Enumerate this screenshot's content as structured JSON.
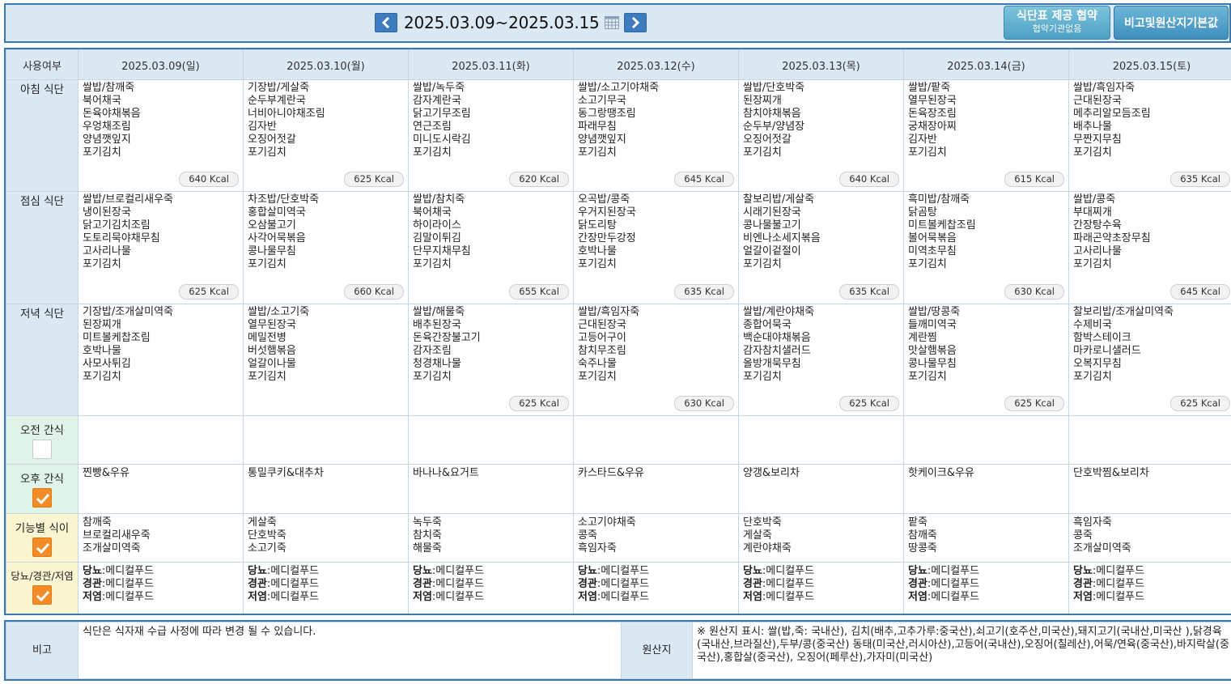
{
  "header": {
    "date_range": "2025.03.09~2025.03.15",
    "agree_button_line1": "식단표 제공 협약",
    "agree_button_line2": "협약기관없음",
    "note_button": "비고및원산지기본값"
  },
  "table": {
    "usage_header": "사용여부",
    "days": [
      "2025.03.09(일)",
      "2025.03.10(월)",
      "2025.03.11(화)",
      "2025.03.12(수)",
      "2025.03.13(목)",
      "2025.03.14(금)",
      "2025.03.15(토)"
    ],
    "meals": [
      {
        "label": "아침 식단",
        "cells": [
          {
            "text": "쌀밥/참깨죽\n북어채국\n돈육야채볶음\n우엉채조림\n양념깻잎지\n포기김치",
            "kcal": "640 Kcal"
          },
          {
            "text": "기장밥/게살죽\n순두부계란국\n너비아니야채조림\n김자반\n오징어젓갈\n포기김치",
            "kcal": "625 Kcal"
          },
          {
            "text": "쌀밥/녹두죽\n감자계란국\n닭고기무조림\n연근조림\n미니도시락김\n포기김치",
            "kcal": "620 Kcal"
          },
          {
            "text": "쌀밥/소고기야채죽\n소고기무국\n동그랑땡조림\n파래무침\n양념깻잎지\n포기김치",
            "kcal": "645 Kcal"
          },
          {
            "text": "쌀밥/단호박죽\n된장찌개\n참치야채볶음\n순두부/양념장\n오징어젓갈\n포기김치",
            "kcal": "640 Kcal"
          },
          {
            "text": "쌀밥/팥죽\n열무된장국\n돈육장조림\n궁채장아찌\n김자반\n포기김치",
            "kcal": "615 Kcal"
          },
          {
            "text": "쌀밥/흑임자죽\n근대된장국\n메추리알모듬조림\n배추나물\n무짠지무침\n포기김치",
            "kcal": "635 Kcal"
          }
        ]
      },
      {
        "label": "점심 식단",
        "cells": [
          {
            "text": "쌀밥/브로컬리새우죽\n냉이된장국\n닭고기김치조림\n도토리묵야채무침\n고사리나물\n포기김치",
            "kcal": "625 Kcal"
          },
          {
            "text": "차조밥/단호박죽\n홍합살미역국\n오삼불고기\n사각어묵볶음\n콩나물무침\n포기김치",
            "kcal": "660 Kcal"
          },
          {
            "text": "쌀밥/참치죽\n북어채국\n하이라이스\n김말이튀김\n단무지채무침\n포기김치",
            "kcal": "655 Kcal"
          },
          {
            "text": "오곡밥/콩죽\n우거지된장국\n닭도리탕\n간장만두강정\n호박나물\n포기김치",
            "kcal": "635 Kcal"
          },
          {
            "text": "찰보리밥/게살죽\n시래기된장국\n콩나물불고기\n비엔나소세지볶음\n얼갈이겉절이\n포기김치",
            "kcal": "635 Kcal"
          },
          {
            "text": "흑미밥/참깨죽\n닭곰탕\n미트볼케찹조림\n볼어묵볶음\n미역초무침\n포기김치",
            "kcal": "630 Kcal"
          },
          {
            "text": "쌀밥/콩죽\n부대찌개\n간장탕수육\n파래곤약초장무침\n고사리나물\n포기김치",
            "kcal": "645 Kcal"
          }
        ]
      },
      {
        "label": "저녁 식단",
        "cells": [
          {
            "text": "기장밥/조개살미역죽\n된장찌개\n미트볼케찹조림\n호박나물\n사모사튀김\n포기김치",
            "kcal": ""
          },
          {
            "text": "쌀밥/소고기죽\n열무된장국\n메밀전병\n버섯햄볶음\n얼갈이나물\n포기김치",
            "kcal": ""
          },
          {
            "text": "쌀밥/해물죽\n배추된장국\n돈육간장불고기\n감자조림\n청경채나물\n포기김치",
            "kcal": "625 Kcal"
          },
          {
            "text": "쌀밥/흑임자죽\n근대된장국\n고등어구이\n참치무조림\n숙주나물\n포기김치",
            "kcal": "630 Kcal"
          },
          {
            "text": "쌀밥/계란야채죽\n종합어묵국\n백순대야채볶음\n감자참치샐러드\n올방개묵무침\n포기김치",
            "kcal": "625 Kcal"
          },
          {
            "text": "쌀밥/땅콩죽\n들깨미역국\n계란찜\n맛살햄볶음\n콩나물무침\n포기김치",
            "kcal": "625 Kcal"
          },
          {
            "text": "찰보리밥/조개살미역죽\n수제비국\n함박스테이크\n마카로니샐러드\n오복지무침\n포기김치",
            "kcal": "625 Kcal"
          }
        ]
      }
    ],
    "am_snack": {
      "label": "오전 간식",
      "checked": false,
      "cells": [
        "",
        "",
        "",
        "",
        "",
        "",
        ""
      ]
    },
    "pm_snack": {
      "label": "오후 간식",
      "checked": true,
      "cells": [
        "찐빵&우유",
        "통밀쿠키&대추차",
        "바나나&요거트",
        "카스타드&우유",
        "양갱&보리차",
        "핫케이크&우유",
        "단호박찜&보리차"
      ]
    },
    "functional": {
      "label": "기능별 식이",
      "checked": true,
      "cells": [
        "참깨죽\n브로컬리새우죽\n조개살미역죽",
        "게살죽\n단호박죽\n소고기죽",
        "녹두죽\n참치죽\n해물죽",
        "소고기야채죽\n콩죽\n흑임자죽",
        "단호박죽\n게살죽\n계란야채죽",
        "팥죽\n참깨죽\n땅콩죽",
        "흑임자죽\n콩죽\n조개살미역죽"
      ]
    },
    "diet": {
      "label": "당뇨/경관/저염",
      "checked": true,
      "k1": "당뇨",
      "k2": "경관",
      "k3": "저염",
      "value": ":메디컬푸드"
    }
  },
  "notes": {
    "remark_label": "비고",
    "remark_text": "식단은 식자재 수급 사정에 따라 변경 될 수 있습니다.",
    "origin_label": "원산지",
    "origin_text": "※ 원산지 표시: 쌀(밥,죽: 국내산), 김치(배추,고추가루:중국산),쇠고기(호주산,미국산),돼지고기(국내산,미국산 ),닭경육(국내산,브라질산),두부/콩(중국산) 동태(미국산,러시아산),고등어(국내산),오징어(칠레산),어묵/연육(중국산),바지락살(중국산),홍합살(중국산), 오징어(페루산),가자미(미국산)"
  },
  "colors": {
    "accent": "#3a78b5",
    "header_bg": "#dbe9f5",
    "sunday": "#e00000",
    "saturday": "#1a3fd6",
    "checkbox_on": "#f28c28"
  }
}
